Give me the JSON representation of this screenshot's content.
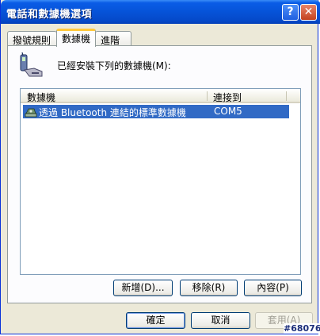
{
  "window": {
    "title": "電話和數據機選項",
    "help": "?",
    "close": "✕"
  },
  "tabs": [
    {
      "label": "撥號規則"
    },
    {
      "label": "數據機"
    },
    {
      "label": "進階"
    }
  ],
  "modems": {
    "label": "已經安裝下列的數據機(M):",
    "columns": {
      "modem": "數據機",
      "attached_to": "連接到"
    },
    "rows": [
      {
        "name": "透過 Bluetooth 連結的標準數據機",
        "port": "COM5"
      }
    ],
    "buttons": {
      "add": "新增(D)...",
      "remove": "移除(R)",
      "properties": "內容(P)"
    }
  },
  "dialog_buttons": {
    "ok": "確定",
    "cancel": "取消",
    "apply": "套用(A)"
  },
  "watermark": "#68076",
  "colors": {
    "title_bar": "#0a5ce6",
    "selection": "#316ac5",
    "tab_highlight": "#ffc83c"
  }
}
